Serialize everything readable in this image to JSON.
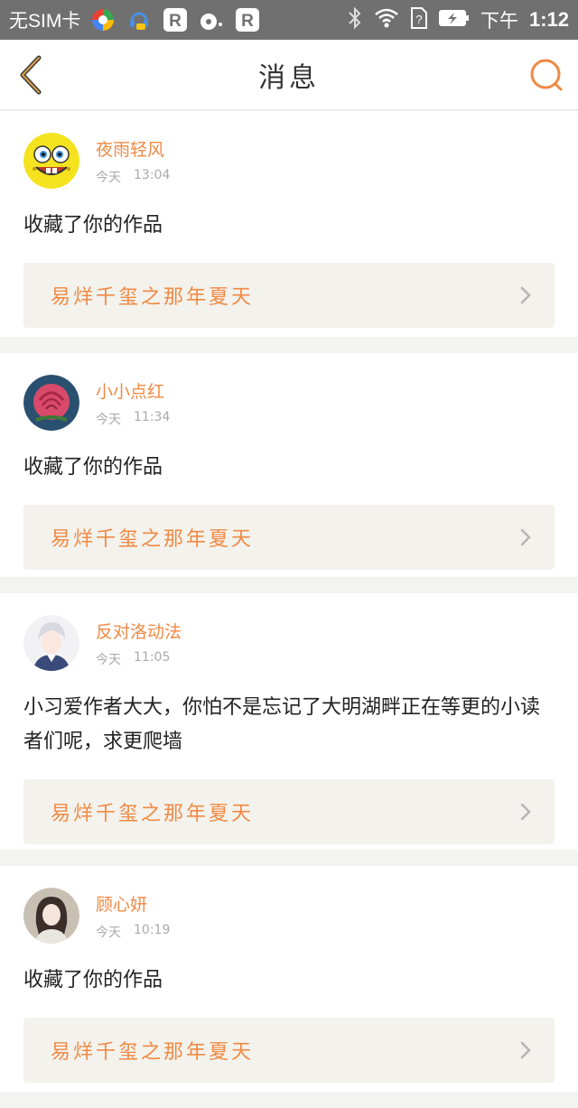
{
  "status_bar": {
    "carrier": "无SIM卡",
    "am_pm": "下午",
    "time": "1:12"
  },
  "header": {
    "title": "消息"
  },
  "messages": [
    {
      "username": "夜雨轻风",
      "day": "今天",
      "time": "13:04",
      "text": "收藏了你的作品",
      "work_title": "易烊千玺之那年夏天"
    },
    {
      "username": "小小点红",
      "day": "今天",
      "time": "11:34",
      "text": "收藏了你的作品",
      "work_title": "易烊千玺之那年夏天"
    },
    {
      "username": "反对洛动法",
      "day": "今天",
      "time": "11:05",
      "text": "小习爱作者大大，你怕不是忘记了大明湖畔正在等更的小读者们呢，求更爬墙",
      "work_title": "易烊千玺之那年夏天"
    },
    {
      "username": "顾心妍",
      "day": "今天",
      "time": "10:19",
      "text": "收藏了你的作品",
      "work_title": "易烊千玺之那年夏天"
    }
  ],
  "colors": {
    "accent": "#f08a45",
    "status_bar_bg": "#707070",
    "link_bg": "#f3f2ec"
  }
}
